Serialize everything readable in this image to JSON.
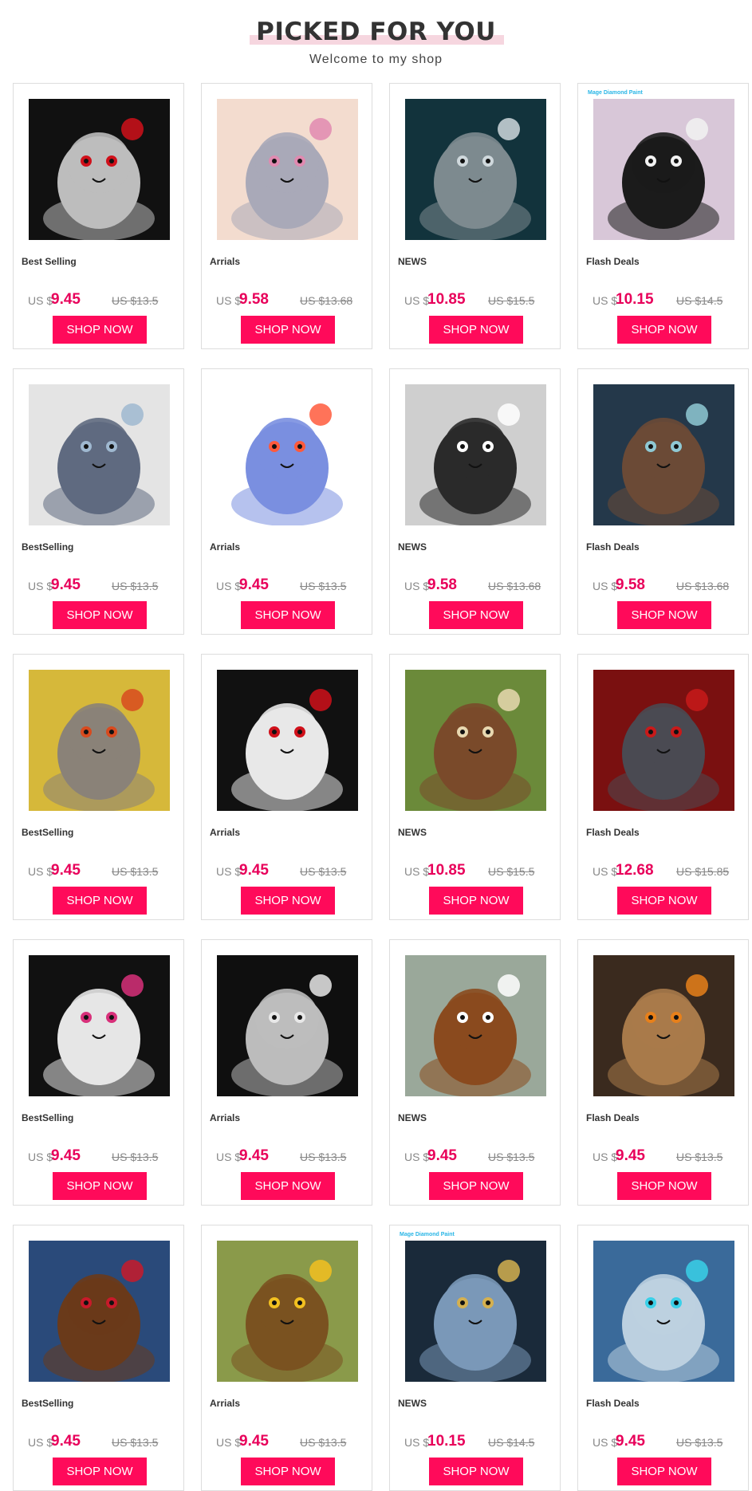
{
  "header": {
    "title": "PICKED FOR YOU",
    "subtitle": "Welcome to my shop"
  },
  "mage_label": "Mage Diamond Paint",
  "currency": "US $",
  "button_label": "SHOP NOW",
  "colors": {
    "accent": "#ff0a5a",
    "price": "#e8005a",
    "title_highlight": "#f6d6df"
  },
  "products": [
    {
      "category": "Best Selling",
      "price": "9.45",
      "old_price": "US $13.5",
      "image": "sugar-skull-elephant-with-rose",
      "bg": "#111111",
      "fg": "#bdbdbd",
      "accent": "#d0101a",
      "mage": false
    },
    {
      "category": "Arrials",
      "price": "9.58",
      "old_price": "US $13.68",
      "image": "grey-bunny-with-easter-basket",
      "bg": "#f3dccf",
      "fg": "#a9a9b8",
      "accent": "#e08ab0",
      "mage": false
    },
    {
      "category": "NEWS",
      "price": "10.85",
      "old_price": "US $15.5",
      "image": "wolves-under-full-moon",
      "bg": "#12333c",
      "fg": "#7d8a8f",
      "accent": "#cfd8dc",
      "mage": false
    },
    {
      "category": "Flash Deals",
      "price": "10.15",
      "old_price": "US $14.5",
      "image": "panda-under-cherry-blossom",
      "bg": "#d8c7d8",
      "fg": "#1b1b1b",
      "accent": "#f2f2f2",
      "mage": true
    },
    {
      "category": "BestSelling",
      "price": "9.45",
      "old_price": "US $13.5",
      "image": "monkey-with-sunglasses",
      "bg": "#e4e4e4",
      "fg": "#5f6a80",
      "accent": "#9fb8d0",
      "mage": false
    },
    {
      "category": "Arrials",
      "price": "9.45",
      "old_price": "US $13.5",
      "image": "colorful-tiger-with-butterflies",
      "bg": "#ffffff",
      "fg": "#7a8fe0",
      "accent": "#ff5a3c",
      "mage": false
    },
    {
      "category": "NEWS",
      "price": "9.58",
      "old_price": "US $13.68",
      "image": "white-tiger-face",
      "bg": "#cfcfcf",
      "fg": "#2a2a2a",
      "accent": "#ffffff",
      "mage": false
    },
    {
      "category": "Flash Deals",
      "price": "9.58",
      "old_price": "US $13.68",
      "image": "sleeping-teddy-bear",
      "bg": "#24384a",
      "fg": "#6b4a36",
      "accent": "#8fc9d4",
      "mage": false
    },
    {
      "category": "BestSelling",
      "price": "9.45",
      "old_price": "US $13.5",
      "image": "tabby-cat-with-berries",
      "bg": "#d6b83a",
      "fg": "#8a8278",
      "accent": "#d84a1e",
      "mage": false
    },
    {
      "category": "Arrials",
      "price": "9.45",
      "old_price": "US $13.5",
      "image": "sugar-skull-bear-with-rose",
      "bg": "#111111",
      "fg": "#e8e8e8",
      "accent": "#d0101a",
      "mage": false
    },
    {
      "category": "NEWS",
      "price": "10.85",
      "old_price": "US $15.5",
      "image": "brown-owl-on-branch",
      "bg": "#6b8a3a",
      "fg": "#7a4a2a",
      "accent": "#e8d8b0",
      "mage": false
    },
    {
      "category": "Flash Deals",
      "price": "12.68",
      "old_price": "US $15.85",
      "image": "dragon-with-skull-cross",
      "bg": "#7a1010",
      "fg": "#4a4a52",
      "accent": "#c81a1a",
      "mage": false
    },
    {
      "category": "BestSelling",
      "price": "9.45",
      "old_price": "US $13.5",
      "image": "sugar-skull-owl-with-rose",
      "bg": "#111111",
      "fg": "#e6e6e6",
      "accent": "#d8307a",
      "mage": false
    },
    {
      "category": "Arrials",
      "price": "9.45",
      "old_price": "US $13.5",
      "image": "black-and-white-lion",
      "bg": "#0f0f0f",
      "fg": "#bcbcbc",
      "accent": "#e8e8e8",
      "mage": false
    },
    {
      "category": "NEWS",
      "price": "9.45",
      "old_price": "US $13.5",
      "image": "spaniel-dog-lying",
      "bg": "#9aa89a",
      "fg": "#8a4a1e",
      "accent": "#ffffff",
      "mage": false
    },
    {
      "category": "Flash Deals",
      "price": "9.45",
      "old_price": "US $13.5",
      "image": "witch-cat-with-pumpkin",
      "bg": "#3a2a1e",
      "fg": "#a87a4a",
      "accent": "#e8801a",
      "mage": false
    },
    {
      "category": "BestSelling",
      "price": "9.45",
      "old_price": "US $13.5",
      "image": "eagle-with-american-flag",
      "bg": "#2a4a7a",
      "fg": "#6a3a1a",
      "accent": "#c81a2a",
      "mage": false
    },
    {
      "category": "Arrials",
      "price": "9.45",
      "old_price": "US $13.5",
      "image": "orange-eyed-owl",
      "bg": "#8a9a4a",
      "fg": "#7a5220",
      "accent": "#f2c020",
      "mage": false
    },
    {
      "category": "NEWS",
      "price": "10.15",
      "old_price": "US $14.5",
      "image": "blue-wolf-with-gold-pattern",
      "bg": "#1a2a3a",
      "fg": "#7a98b8",
      "accent": "#d4b050",
      "mage": true
    },
    {
      "category": "Flash Deals",
      "price": "9.45",
      "old_price": "US $13.5",
      "image": "blue-eyed-wolves-in-snow",
      "bg": "#3a6a9a",
      "fg": "#bcd0e0",
      "accent": "#3ad0e8",
      "mage": false
    }
  ]
}
